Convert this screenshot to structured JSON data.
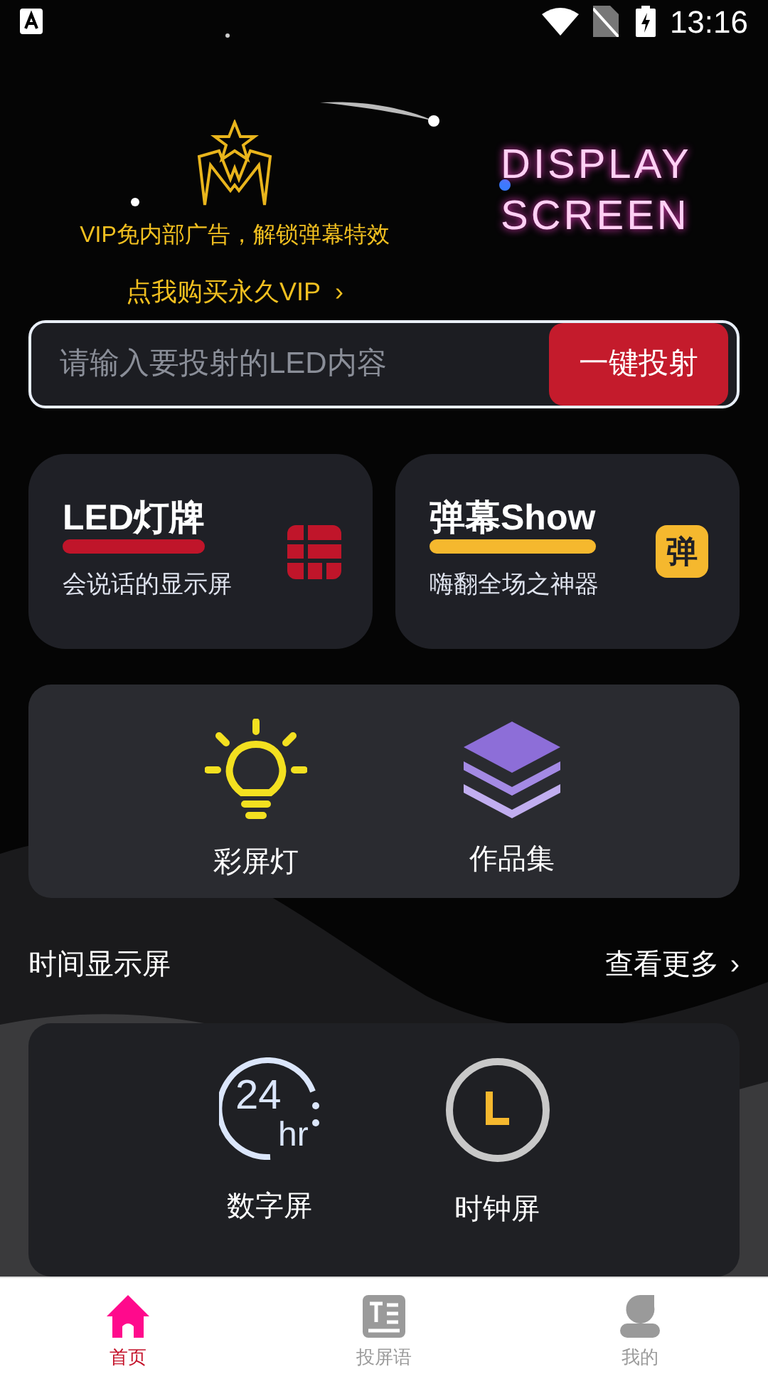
{
  "status_bar": {
    "time": "13:16"
  },
  "hero": {
    "vip_text": "VIP免内部广告，解锁弹幕特效",
    "vip_link": "点我购买永久VIP",
    "vip_chevron": "›",
    "logo_lines": [
      "DISPLAY",
      "SCREEN"
    ]
  },
  "cast_input": {
    "placeholder": "请输入要投射的LED内容",
    "button": "一键投射"
  },
  "feature_cards": [
    {
      "kind": "led",
      "title": "LED灯牌",
      "subtitle": "会说话的显示屏",
      "color": "#c0152a"
    },
    {
      "kind": "danmu",
      "title": "弹幕Show",
      "subtitle": "嗨翻全场之神器",
      "color": "#f5b82e",
      "badge": "弹"
    }
  ],
  "tools": [
    {
      "kind": "bulb",
      "label": "彩屏灯"
    },
    {
      "kind": "layers",
      "label": "作品集"
    }
  ],
  "time_section": {
    "title": "时间显示屏",
    "more": "查看更多",
    "more_chevron": "›"
  },
  "time_items": [
    {
      "kind": "digital",
      "label": "数字屏",
      "icon_number": "24",
      "icon_unit": "hr"
    },
    {
      "kind": "clock",
      "label": "时钟屏"
    }
  ],
  "bottom_nav": [
    {
      "kind": "home",
      "label": "首页",
      "selected": true
    },
    {
      "kind": "text",
      "label": "投屏语",
      "selected": false
    },
    {
      "kind": "user",
      "label": "我的",
      "selected": false
    }
  ]
}
